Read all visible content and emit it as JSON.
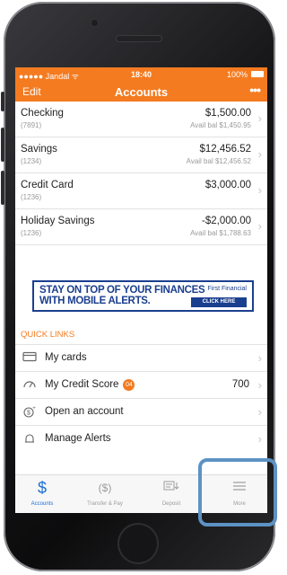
{
  "status_bar": {
    "carrier": "●●●●● Jandal ᯤ",
    "time": "18:40",
    "battery": "100%"
  },
  "nav": {
    "edit": "Edit",
    "title": "Accounts",
    "more": "•••"
  },
  "accounts": [
    {
      "name": "Checking",
      "number": "(7891)",
      "amount": "$1,500.00",
      "avail": "Avail bal $1,450.95"
    },
    {
      "name": "Savings",
      "number": "(1234)",
      "amount": "$12,456.52",
      "avail": "Avail bal $12,456.52"
    },
    {
      "name": "Credit Card",
      "number": "(1236)",
      "amount": "$3,000.00",
      "avail": ""
    },
    {
      "name": "Holiday Savings",
      "number": "(1236)",
      "amount": "-$2,000.00",
      "avail": "Avail bal $1,788.63"
    }
  ],
  "banner": {
    "line1": "STAY ON TOP OF YOUR FINANCES",
    "line2": "WITH MOBILE ALERTS.",
    "brand": "First Financial",
    "cta": "CLICK HERE"
  },
  "quick_links": {
    "header": "QUICK LINKS",
    "items": [
      {
        "label": "My cards",
        "icon": "card-icon",
        "badge": "",
        "value": ""
      },
      {
        "label": "My Credit Score",
        "icon": "gauge-icon",
        "badge": "04",
        "value": "700"
      },
      {
        "label": "Open an account",
        "icon": "dollar-plus-icon",
        "badge": "",
        "value": ""
      },
      {
        "label": "Manage Alerts",
        "icon": "bell-icon",
        "badge": "",
        "value": ""
      }
    ]
  },
  "tabs": [
    {
      "label": "Accounts",
      "icon": "dollar-icon",
      "active": true
    },
    {
      "label": "Transfer & Pay",
      "icon": "transfer-icon",
      "active": false
    },
    {
      "label": "Deposit",
      "icon": "deposit-icon",
      "active": false
    },
    {
      "label": "More",
      "icon": "menu-icon",
      "active": false
    }
  ],
  "colors": {
    "brand_orange": "#f47b20",
    "active_blue": "#1e6fd0",
    "highlight": "#5d92c5"
  }
}
